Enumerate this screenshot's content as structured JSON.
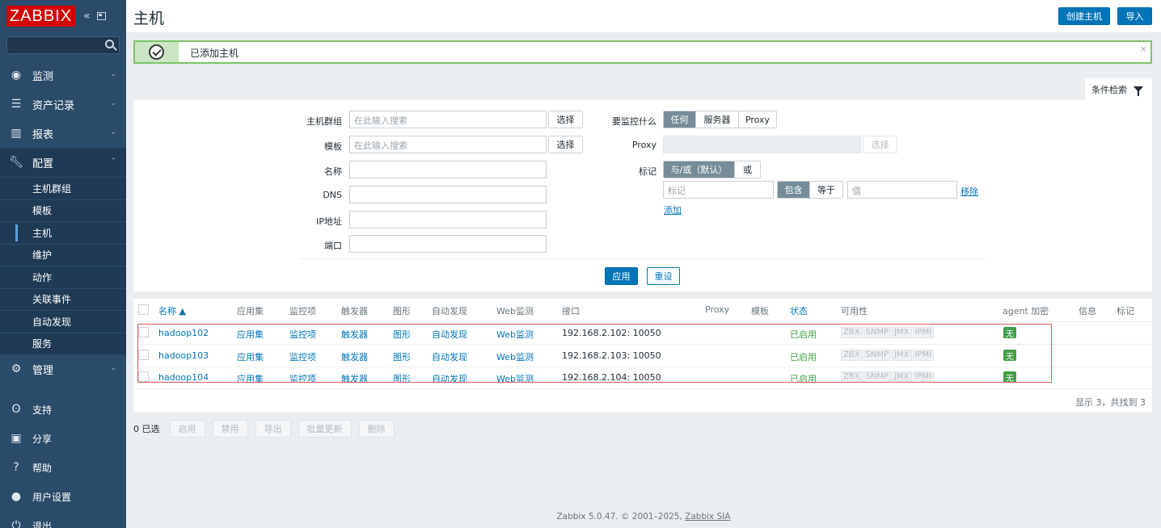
{
  "sidebar": {
    "logo": "ZABBIX",
    "search_placeholder": "",
    "menu": [
      {
        "label": "监测",
        "icon": "eye-icon"
      },
      {
        "label": "资产记录",
        "icon": "list-icon"
      },
      {
        "label": "报表",
        "icon": "chart-icon"
      },
      {
        "label": "配置",
        "icon": "wrench-icon"
      }
    ],
    "config_sub": [
      "主机群组",
      "模板",
      "主机",
      "维护",
      "动作",
      "关联事件",
      "自动发现",
      "服务"
    ],
    "admin": {
      "label": "管理",
      "icon": "gear-box-icon"
    },
    "bottom": [
      {
        "label": "支持",
        "icon": "headset-icon"
      },
      {
        "label": "分享",
        "icon": "share-z-icon"
      },
      {
        "label": "帮助",
        "icon": "question-icon"
      },
      {
        "label": "用户设置",
        "icon": "user-icon"
      },
      {
        "label": "退出",
        "icon": "power-icon"
      }
    ]
  },
  "header": {
    "title": "主机",
    "create_host": "创建主机",
    "import": "导入"
  },
  "message": {
    "text": "已添加主机",
    "close": "×"
  },
  "filter": {
    "tab_label": "条件检索",
    "host_group_label": "主机群组",
    "host_group_placeholder": "在此输入搜索",
    "template_label": "模板",
    "template_placeholder": "在此输入搜索",
    "select": "选择",
    "name_label": "名称",
    "dns_label": "DNS",
    "ip_label": "IP地址",
    "port_label": "端口",
    "monitored_by_label": "要监控什么",
    "monitored_by_options": [
      "任何",
      "服务器",
      "Proxy"
    ],
    "proxy_label": "Proxy",
    "proxy_select": "选择",
    "tags_label": "标记",
    "tags_mode": [
      "与/或（默认）",
      "或"
    ],
    "tag_placeholder": "标记",
    "tag_ops": [
      "包含",
      "等于"
    ],
    "value_placeholder": "值",
    "remove": "移除",
    "add": "添加",
    "apply": "应用",
    "reset": "重设"
  },
  "table": {
    "headers": {
      "name": "名称 ▲",
      "apps": "应用集",
      "items": "监控项",
      "triggers": "触发器",
      "graphs": "图形",
      "discovery": "自动发现",
      "web": "Web监测",
      "interface": "接口",
      "proxy": "Proxy",
      "templates": "模板",
      "status": "状态",
      "availability": "可用性",
      "agent_encryption": "agent 加密",
      "info": "信息",
      "tags": "标记"
    },
    "rows": [
      {
        "name": "hadoop102",
        "apps": "应用集",
        "items": "监控项",
        "triggers": "触发器",
        "graphs": "图形",
        "discovery": "自动发现",
        "web": "Web监测",
        "interface": "192.168.2.102: 10050",
        "status": "已启用",
        "avail": [
          "ZBX",
          "SNMP",
          "JMX",
          "IPMI"
        ],
        "encryption": "无"
      },
      {
        "name": "hadoop103",
        "apps": "应用集",
        "items": "监控项",
        "triggers": "触发器",
        "graphs": "图形",
        "discovery": "自动发现",
        "web": "Web监测",
        "interface": "192.168.2.103: 10050",
        "status": "已启用",
        "avail": [
          "ZBX",
          "SNMP",
          "JMX",
          "IPMI"
        ],
        "encryption": "无"
      },
      {
        "name": "hadoop104",
        "apps": "应用集",
        "items": "监控项",
        "triggers": "触发器",
        "graphs": "图形",
        "discovery": "自动发现",
        "web": "Web监测",
        "interface": "192.168.2.104: 10050",
        "status": "已启用",
        "avail": [
          "ZBX",
          "SNMP",
          "JMX",
          "IPMI"
        ],
        "encryption": "无"
      }
    ],
    "summary": "显示 3，共找到 3"
  },
  "actions": {
    "selected": "0 已选",
    "buttons": [
      "启用",
      "禁用",
      "导出",
      "批量更新",
      "删除"
    ]
  },
  "footer": {
    "prefix": "Zabbix 5.0.47. © 2001–2025, ",
    "company": "Zabbix SIA"
  }
}
